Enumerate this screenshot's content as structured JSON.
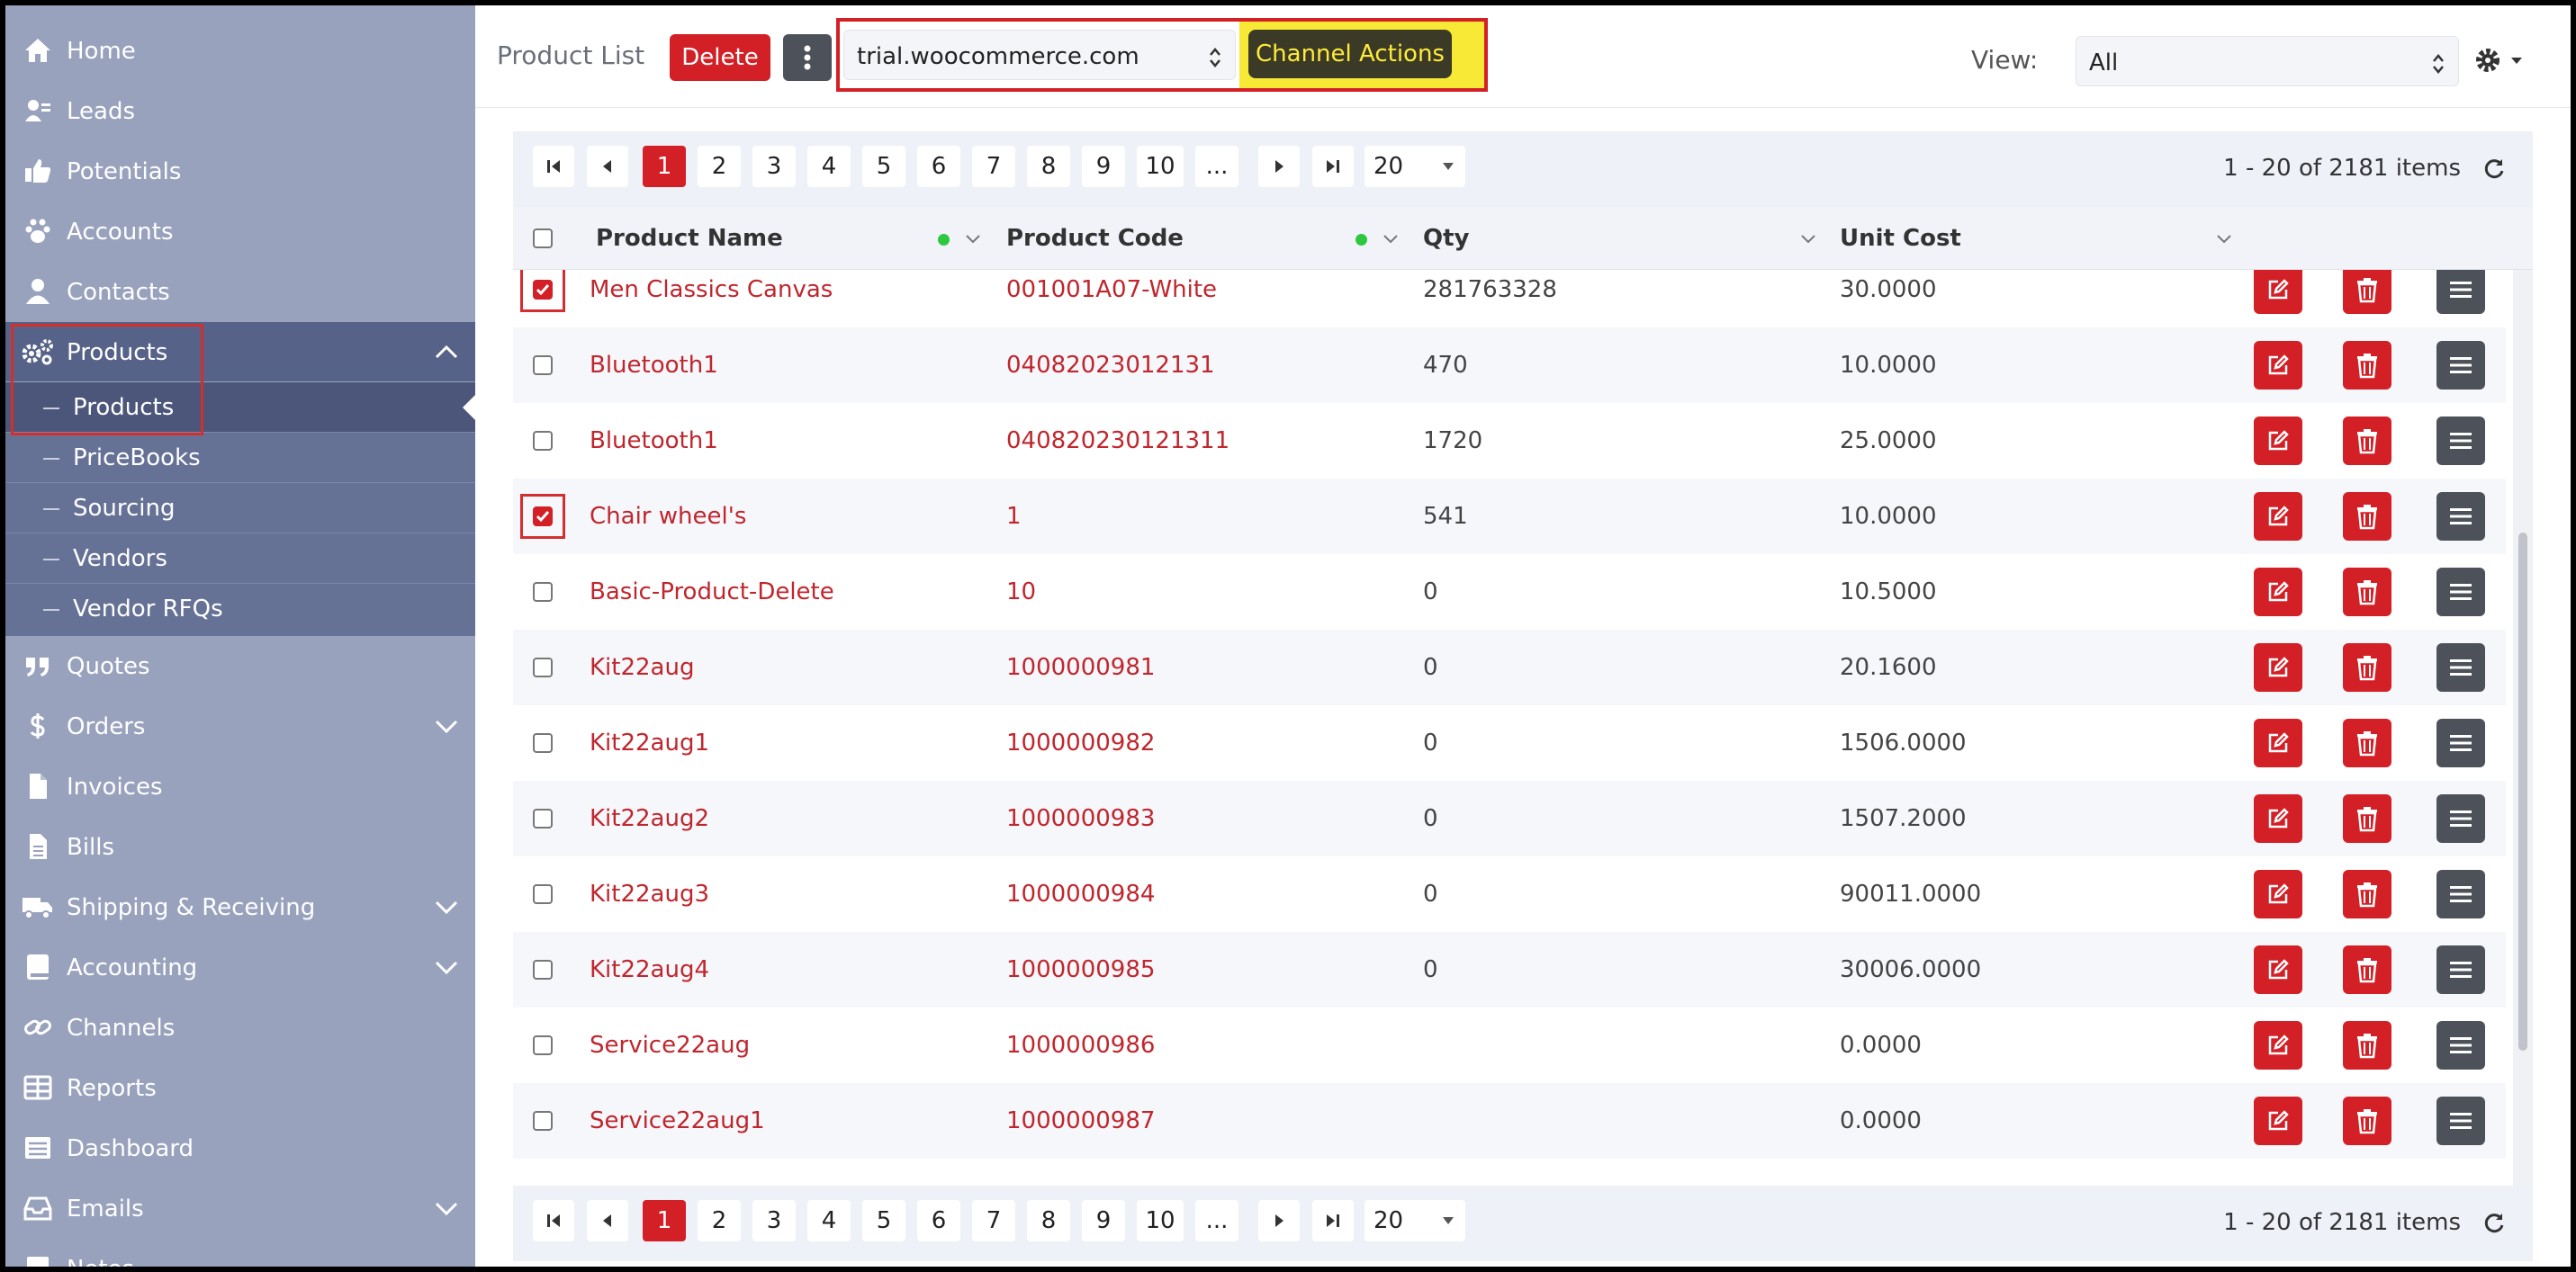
{
  "sidebar": {
    "items": [
      {
        "label": "Home",
        "icon": "home-icon"
      },
      {
        "label": "Leads",
        "icon": "leads-icon"
      },
      {
        "label": "Potentials",
        "icon": "thumbs-up-icon"
      },
      {
        "label": "Accounts",
        "icon": "paw-icon"
      },
      {
        "label": "Contacts",
        "icon": "user-icon"
      },
      {
        "label": "Products",
        "icon": "gears-icon"
      },
      {
        "label": "Quotes",
        "icon": "quote-icon"
      },
      {
        "label": "Orders",
        "icon": "dollar-icon"
      },
      {
        "label": "Invoices",
        "icon": "file-icon"
      },
      {
        "label": "Bills",
        "icon": "file-text-icon"
      },
      {
        "label": "Shipping & Receiving",
        "icon": "truck-icon"
      },
      {
        "label": "Accounting",
        "icon": "book-icon"
      },
      {
        "label": "Channels",
        "icon": "link-icon"
      },
      {
        "label": "Reports",
        "icon": "table-icon"
      },
      {
        "label": "Dashboard",
        "icon": "list-icon"
      },
      {
        "label": "Emails",
        "icon": "inbox-icon"
      },
      {
        "label": "Notes",
        "icon": "note-icon"
      }
    ],
    "products_sub": [
      "Products",
      "PriceBooks",
      "Sourcing",
      "Vendors",
      "Vendor RFQs"
    ]
  },
  "toolbar": {
    "title": "Product List",
    "delete_label": "Delete",
    "channel_value": "trial.woocommerce.com",
    "channel_actions_label": "Channel Actions",
    "view_label": "View:",
    "view_value": "All"
  },
  "pager": {
    "pages": [
      "1",
      "2",
      "3",
      "4",
      "5",
      "6",
      "7",
      "8",
      "9",
      "10",
      "..."
    ],
    "current": "1",
    "page_size": "20",
    "info": "1 - 20 of 2181 items"
  },
  "table": {
    "columns": [
      "Product Name",
      "Product Code",
      "Qty",
      "Unit Cost"
    ],
    "rows": [
      {
        "name": "Men Classics Canvas",
        "code": "001001A07-White",
        "qty": "281763328",
        "cost": "30.0000",
        "checked": true
      },
      {
        "name": "Bluetooth1",
        "code": "04082023012131",
        "qty": "470",
        "cost": "10.0000",
        "checked": false
      },
      {
        "name": "Bluetooth1",
        "code": "040820230121311",
        "qty": "1720",
        "cost": "25.0000",
        "checked": false
      },
      {
        "name": "Chair wheel's",
        "code": "1",
        "qty": "541",
        "cost": "10.0000",
        "checked": true
      },
      {
        "name": "Basic-Product-Delete",
        "code": "10",
        "qty": "0",
        "cost": "10.5000",
        "checked": false
      },
      {
        "name": "Kit22aug",
        "code": "1000000981",
        "qty": "0",
        "cost": "20.1600",
        "checked": false
      },
      {
        "name": "Kit22aug1",
        "code": "1000000982",
        "qty": "0",
        "cost": "1506.0000",
        "checked": false
      },
      {
        "name": "Kit22aug2",
        "code": "1000000983",
        "qty": "0",
        "cost": "1507.2000",
        "checked": false
      },
      {
        "name": "Kit22aug3",
        "code": "1000000984",
        "qty": "0",
        "cost": "90011.0000",
        "checked": false
      },
      {
        "name": "Kit22aug4",
        "code": "1000000985",
        "qty": "0",
        "cost": "30006.0000",
        "checked": false
      },
      {
        "name": "Service22aug",
        "code": "1000000986",
        "qty": "",
        "cost": "0.0000",
        "checked": false
      },
      {
        "name": "Service22aug1",
        "code": "1000000987",
        "qty": "",
        "cost": "0.0000",
        "checked": false
      }
    ]
  },
  "colors": {
    "accent": "#d32027",
    "sidebar": "#99a2bd",
    "sidebar_active": "#566287",
    "highlight": "#f7e935"
  }
}
